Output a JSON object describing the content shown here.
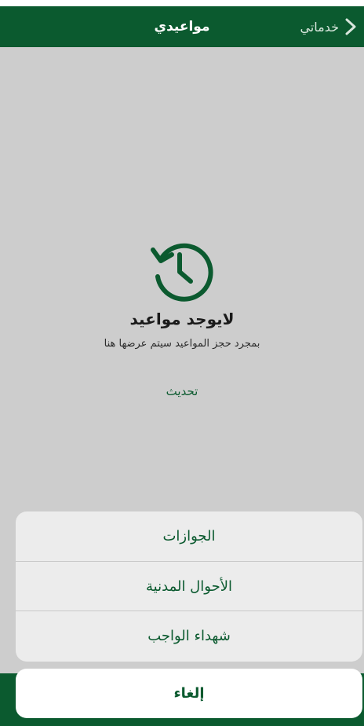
{
  "header": {
    "title": "مواعيدي",
    "back_label": "خدماتي"
  },
  "empty_state": {
    "icon": "history-icon",
    "title": "لايوجد مواعيد",
    "description": "بمجرد حجز المواعيد سيتم عرضها هنا",
    "refresh_label": "تحديث"
  },
  "action_sheet": {
    "options": [
      {
        "label": "الجوازات"
      },
      {
        "label": "الأحوال المدنية"
      },
      {
        "label": "شهداء الواجب"
      }
    ],
    "cancel_label": "إلغاء"
  },
  "colors": {
    "brand_green": "#0b5a2f",
    "overlay_gray": "#cdcdcd",
    "sheet_bg": "#ececec"
  }
}
